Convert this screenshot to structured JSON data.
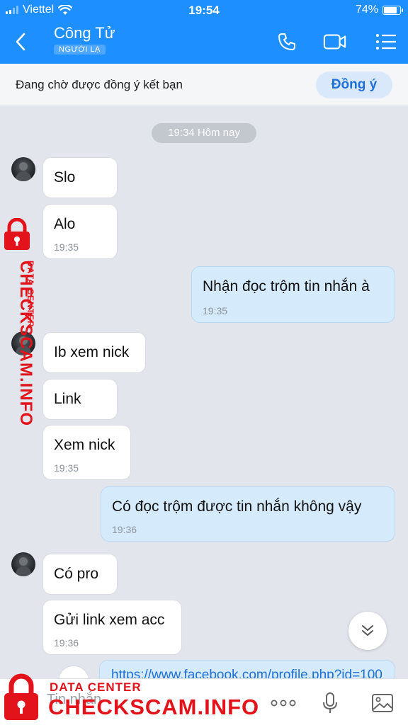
{
  "status_bar": {
    "carrier": "Viettel",
    "time": "19:54",
    "battery": "74%",
    "battery_level": 0.74
  },
  "header": {
    "contact_name": "Công Tử",
    "badge": "NGƯỜI LẠ"
  },
  "friend_request": {
    "text": "Đang chờ được đồng ý kết bạn",
    "accept_label": "Đồng ý"
  },
  "chat": {
    "time_divider": "19:34 Hôm nay",
    "messages": [
      {
        "text": "Slo"
      },
      {
        "text": "Alo",
        "time": "19:35"
      },
      {
        "text": "Nhận đọc trộm tin nhắn à",
        "time": "19:35"
      },
      {
        "text": "Ib xem nick"
      },
      {
        "text": "Link"
      },
      {
        "text": "Xem nick",
        "time": "19:35"
      },
      {
        "text": "Có đọc trộm được tin nhắn không vậy",
        "time": "19:36"
      },
      {
        "text": "Có pro"
      },
      {
        "text": "Gửi link xem acc",
        "time": "19:36"
      }
    ],
    "partial_link": "https://www.facebook.com/profile.php?id=100"
  },
  "input": {
    "placeholder": "Tin nhắn"
  },
  "watermark": {
    "sub": "DATA CENTER",
    "main": "CHECKSCAM.INFO",
    "color": "#e3131b"
  },
  "colors": {
    "header": "#1e8fff",
    "outgoing": "#d5ebfc",
    "incoming": "#ffffff",
    "accent": "#1f6fd6"
  }
}
